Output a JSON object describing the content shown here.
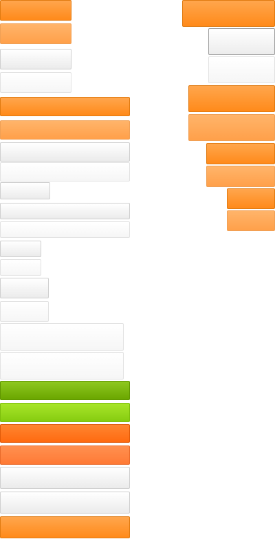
{
  "sprite_sheet": {
    "left_column": [
      {
        "variant": "orange"
      },
      {
        "variant": "orange-light"
      },
      {
        "variant": "gray"
      },
      {
        "variant": "gray-light"
      },
      {
        "variant": "orange"
      },
      {
        "variant": "orange-light"
      },
      {
        "variant": "gray"
      },
      {
        "variant": "gray-light"
      },
      {
        "variant": "gray"
      },
      {
        "variant": "gray"
      },
      {
        "variant": "gray-light"
      },
      {
        "variant": "gray"
      },
      {
        "variant": "gray-light"
      },
      {
        "variant": "gray"
      },
      {
        "variant": "gray-light"
      },
      {
        "variant": "gray-light"
      },
      {
        "variant": "gray-light"
      },
      {
        "variant": "green"
      },
      {
        "variant": "green-light"
      },
      {
        "variant": "red-orange"
      },
      {
        "variant": "red-orange-light"
      },
      {
        "variant": "gray"
      },
      {
        "variant": "gray"
      },
      {
        "variant": "orange"
      }
    ],
    "right_column": [
      {
        "variant": "orange"
      },
      {
        "variant": "gray-dark-border"
      },
      {
        "variant": "gray-light"
      },
      {
        "variant": "orange"
      },
      {
        "variant": "orange-light"
      },
      {
        "variant": "orange"
      },
      {
        "variant": "orange-light"
      },
      {
        "variant": "orange"
      },
      {
        "variant": "orange-light"
      }
    ],
    "colors": {
      "orange": "#ff8a1a",
      "orange_light": "#ffa04a",
      "green": "#6aa600",
      "green_light": "#86cc10",
      "red_orange": "#ff6a10",
      "gray_border": "#cfcfcf"
    }
  }
}
